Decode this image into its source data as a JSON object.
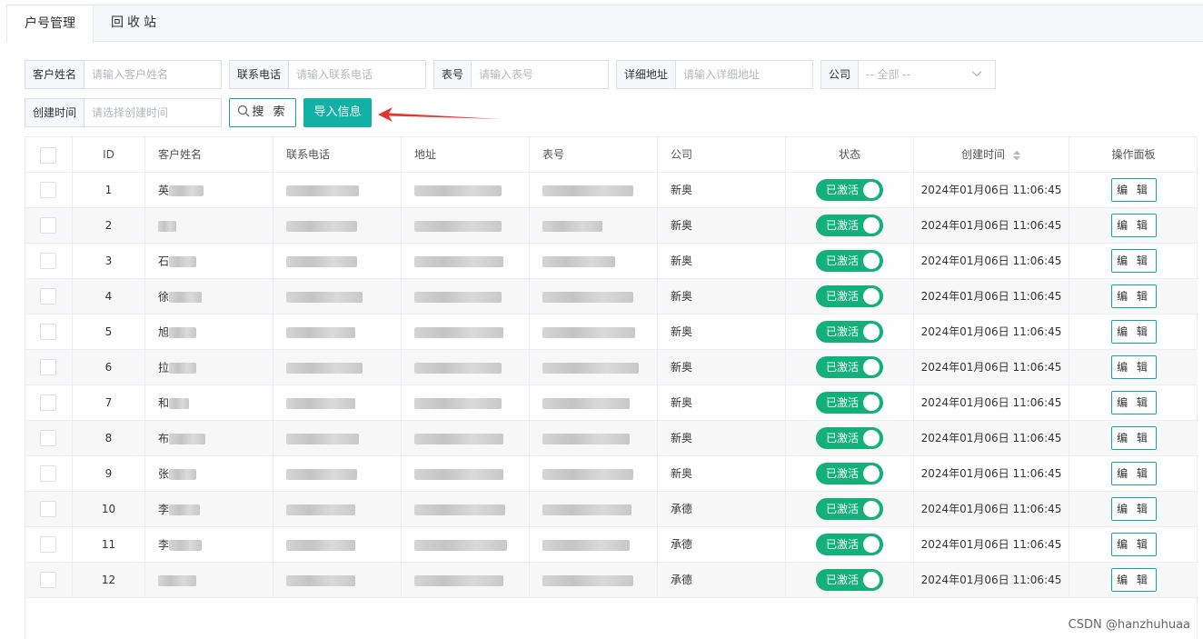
{
  "tabs": [
    {
      "label": "户号管理",
      "active": true
    },
    {
      "label": "回收站",
      "active": false
    }
  ],
  "filters": {
    "customer_name": {
      "label": "客户姓名",
      "placeholder": "请输入客户姓名"
    },
    "phone": {
      "label": "联系电话",
      "placeholder": "请输入联系电话"
    },
    "meter_no": {
      "label": "表号",
      "placeholder": "请输入表号"
    },
    "address": {
      "label": "详细地址",
      "placeholder": "请输入详细地址"
    },
    "company": {
      "label": "公司",
      "value": "-- 全部 --"
    },
    "created_time": {
      "label": "创建时间",
      "placeholder": "请选择创建时间"
    }
  },
  "buttons": {
    "search": "搜 索",
    "import": "导入信息"
  },
  "table": {
    "headers": [
      "ID",
      "客户姓名",
      "联系电话",
      "地址",
      "表号",
      "公司",
      "状态",
      "创建时间",
      "操作面板"
    ],
    "rows": [
      {
        "id": "1",
        "name": "英",
        "company": "新奥",
        "status": "已激活",
        "created": "2024年01月06日 11:06:45",
        "action": "编 辑"
      },
      {
        "id": "2",
        "name": "",
        "company": "新奥",
        "status": "已激活",
        "created": "2024年01月06日 11:06:45",
        "action": "编 辑"
      },
      {
        "id": "3",
        "name": "石",
        "company": "新奥",
        "status": "已激活",
        "created": "2024年01月06日 11:06:45",
        "action": "编 辑"
      },
      {
        "id": "4",
        "name": "徐",
        "company": "新奥",
        "status": "已激活",
        "created": "2024年01月06日 11:06:45",
        "action": "编 辑"
      },
      {
        "id": "5",
        "name": "旭",
        "company": "新奥",
        "status": "已激活",
        "created": "2024年01月06日 11:06:45",
        "action": "编 辑"
      },
      {
        "id": "6",
        "name": "拉",
        "company": "新奥",
        "status": "已激活",
        "created": "2024年01月06日 11:06:45",
        "action": "编 辑"
      },
      {
        "id": "7",
        "name": "和",
        "company": "新奥",
        "status": "已激活",
        "created": "2024年01月06日 11:06:45",
        "action": "编 辑"
      },
      {
        "id": "8",
        "name": "布",
        "company": "新奥",
        "status": "已激活",
        "created": "2024年01月06日 11:06:45",
        "action": "编 辑"
      },
      {
        "id": "9",
        "name": "张",
        "company": "新奥",
        "status": "已激活",
        "created": "2024年01月06日 11:06:45",
        "action": "编 辑"
      },
      {
        "id": "10",
        "name": "李",
        "company": "承德",
        "status": "已激活",
        "created": "2024年01月06日 11:06:45",
        "action": "编 辑"
      },
      {
        "id": "11",
        "name": "李",
        "company": "承德",
        "status": "已激活",
        "created": "2024年01月06日 11:06:45",
        "action": "编 辑"
      },
      {
        "id": "12",
        "name": "",
        "company": "承德",
        "status": "已激活",
        "created": "2024年01月06日 11:06:45",
        "action": "编 辑"
      }
    ]
  },
  "watermark": "CSDN @hanzhuhuaa",
  "colors": {
    "accent": "#13b0a5",
    "switch_on": "#13b07a",
    "arrow": "#e8332a"
  }
}
